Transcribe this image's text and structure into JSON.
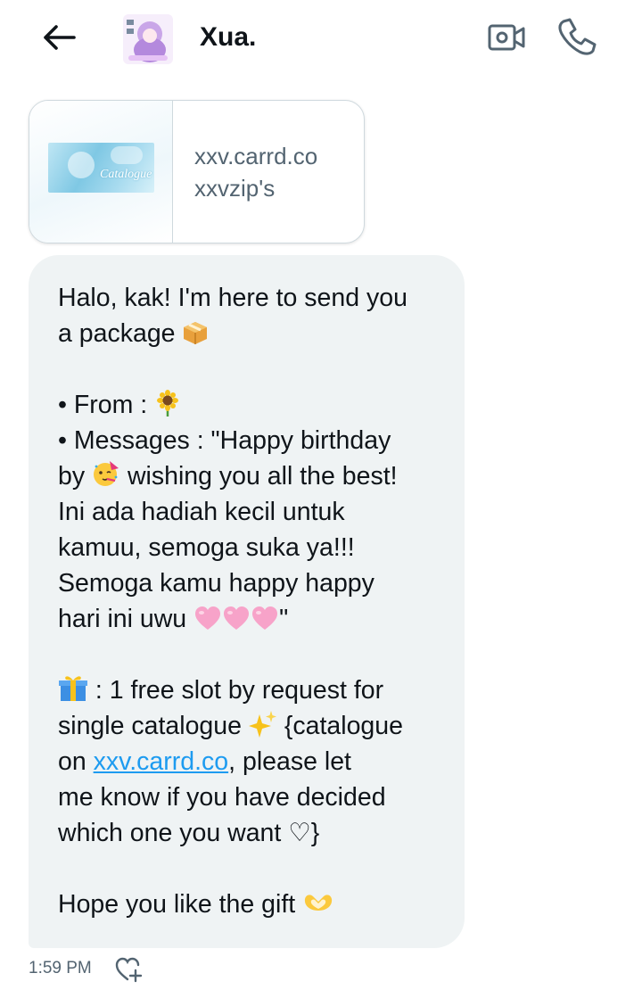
{
  "header": {
    "back_icon": "arrow-left-icon",
    "contact_name": "Xua.",
    "video_icon": "video-camera-icon",
    "call_icon": "phone-icon"
  },
  "link_preview": {
    "thumbnail_text": "Catalogue",
    "domain": "xxv.carrd.co",
    "title": "xxvzip's"
  },
  "message": {
    "lines": [
      "Halo, kak! I'm here to send you",
      "a package",
      "• From :",
      "• Messages : \"Happy birthday",
      "by",
      "wishing you all the best!",
      "Ini ada hadiah kecil untuk",
      "kamuu, semoga suka ya!!!",
      "Semoga kamu happy happy",
      "hari ini uwu",
      "\"",
      ": 1 free slot by request for",
      "single catalogue",
      "{catalogue",
      "on",
      "xxv.carrd.co",
      ", please let",
      "me know if you have decided",
      "which one you want ♡}",
      "Hope you like the gift"
    ],
    "emojis": {
      "package": "package-emoji",
      "sunflower": "sunflower-emoji",
      "party_face": "partying-face-emoji",
      "hearts": "pink-heart-emoji",
      "gift": "wrapped-gift-emoji",
      "sparkles": "sparkles-emoji",
      "heart_hands": "heart-hands-emoji"
    }
  },
  "footer": {
    "timestamp": "1:59 PM",
    "react_icon": "add-reaction-heart-icon"
  },
  "colors": {
    "bubble_bg": "#eff3f4",
    "link": "#1d9bf0",
    "secondary_text": "#536471",
    "heart_pink": "#f7a3c9"
  }
}
